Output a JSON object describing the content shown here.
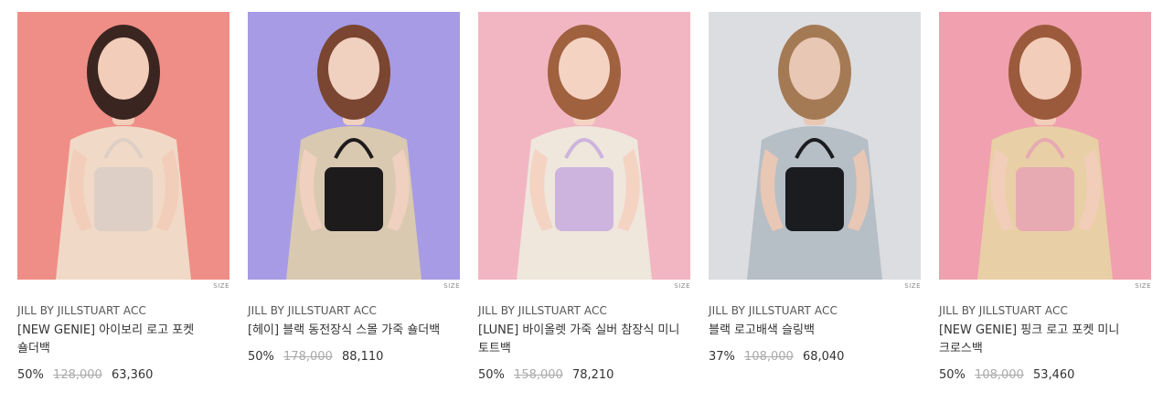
{
  "products": [
    {
      "brand": "JILL BY JILLSTUART ACC",
      "name": "[NEW GENIE] 아이보리 로고 포켓 숄더백",
      "discount": "50%",
      "original_price": "128,000",
      "price": "63,360",
      "size_label": "SIZE",
      "image": {
        "background": "#ef8e86",
        "bag_color": "#ddcfc6",
        "top_color": "#f0d9c6",
        "hair_color": "#3b2520",
        "skin_color": "#f2cdb9"
      }
    },
    {
      "brand": "JILL BY JILLSTUART ACC",
      "name": "[헤이] 블랙 동전장식 스몰 가죽 숄더백",
      "discount": "50%",
      "original_price": "178,000",
      "price": "88,110",
      "size_label": "SIZE",
      "image": {
        "background": "#a69be4",
        "bag_color": "#1e1b1d",
        "top_color": "#d9c9b1",
        "hair_color": "#7a4531",
        "skin_color": "#f0d0bf"
      }
    },
    {
      "brand": "JILL BY JILLSTUART ACC",
      "name": "[LUNE] 바이올렛 가죽 실버 참장식 미니 토트백",
      "discount": "50%",
      "original_price": "158,000",
      "price": "78,210",
      "size_label": "SIZE",
      "image": {
        "background": "#f2b6c3",
        "bag_color": "#cdb4de",
        "top_color": "#efe6dc",
        "hair_color": "#a0613f",
        "skin_color": "#f4d3c3"
      }
    },
    {
      "brand": "JILL BY JILLSTUART ACC",
      "name": "블랙 로고배색 슬링백",
      "discount": "37%",
      "original_price": "108,000",
      "price": "68,040",
      "size_label": "SIZE",
      "image": {
        "background": "#dcdde0",
        "bag_color": "#1b1c20",
        "top_color": "#b6bec6",
        "hair_color": "#a47a55",
        "skin_color": "#e8c7b4"
      }
    },
    {
      "brand": "JILL BY JILLSTUART ACC",
      "name": "[NEW GENIE] 핑크 로고 포켓 미니 크로스백",
      "discount": "50%",
      "original_price": "108,000",
      "price": "53,460",
      "size_label": "SIZE",
      "image": {
        "background": "#f0a0af",
        "bag_color": "#e7a9b2",
        "top_color": "#e8cfa5",
        "hair_color": "#9c5a3c",
        "skin_color": "#f2cdb9"
      }
    }
  ]
}
